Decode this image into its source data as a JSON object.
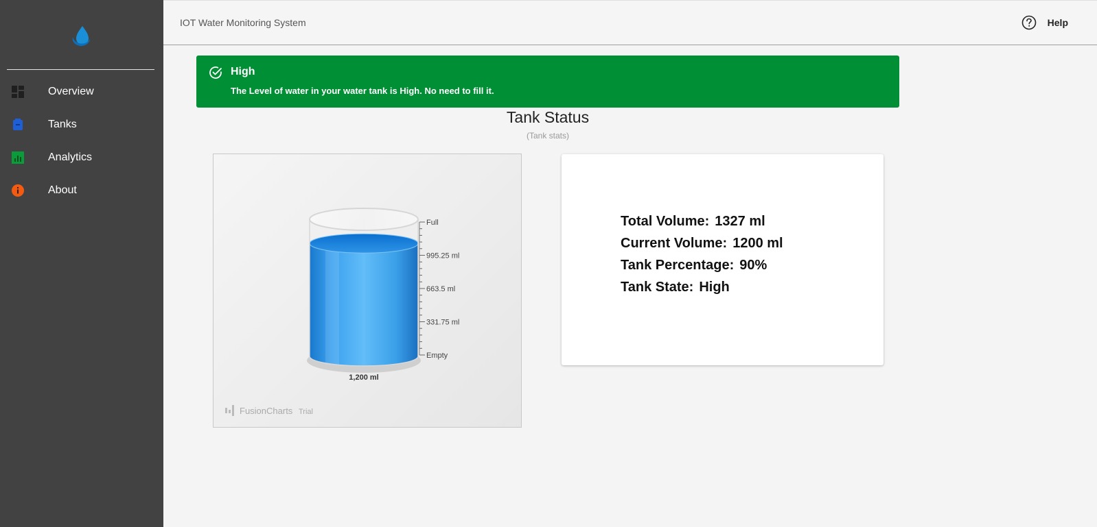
{
  "header": {
    "title": "IOT Water Monitoring System",
    "help_label": "Help"
  },
  "sidebar": {
    "items": [
      {
        "label": "Overview",
        "icon": "dashboard-icon",
        "color": "#212121"
      },
      {
        "label": "Tanks",
        "icon": "tank-icon",
        "color": "#1e5fd6"
      },
      {
        "label": "Analytics",
        "icon": "analytics-icon",
        "color": "#0a9b3a"
      },
      {
        "label": "About",
        "icon": "info-icon",
        "color": "#f45b10"
      }
    ]
  },
  "alert": {
    "title": "High",
    "message": "The Level of water in your water tank is High. No need to fill it.",
    "color": "#008f35"
  },
  "section": {
    "title": "Tank Status",
    "subtitle": "(Tank stats)"
  },
  "chart_data": {
    "type": "cylinder-gauge",
    "value": 1200,
    "value_label": "1,200 ml",
    "max": 1327,
    "fill_fraction": 0.9,
    "ticks": [
      "Full",
      "995.25 ml",
      "663.5 ml",
      "331.75 ml",
      "Empty"
    ],
    "watermark": "FusionCharts",
    "watermark_suffix": "Trial",
    "fill_color": "#1e8fe0"
  },
  "stats": {
    "total_volume_label": "Total Volume:",
    "total_volume_value": "1327 ml",
    "current_volume_label": "Current Volume:",
    "current_volume_value": "1200 ml",
    "tank_percentage_label": "Tank Percentage:",
    "tank_percentage_value": "90%",
    "tank_state_label": "Tank State:",
    "tank_state_value": "High"
  }
}
